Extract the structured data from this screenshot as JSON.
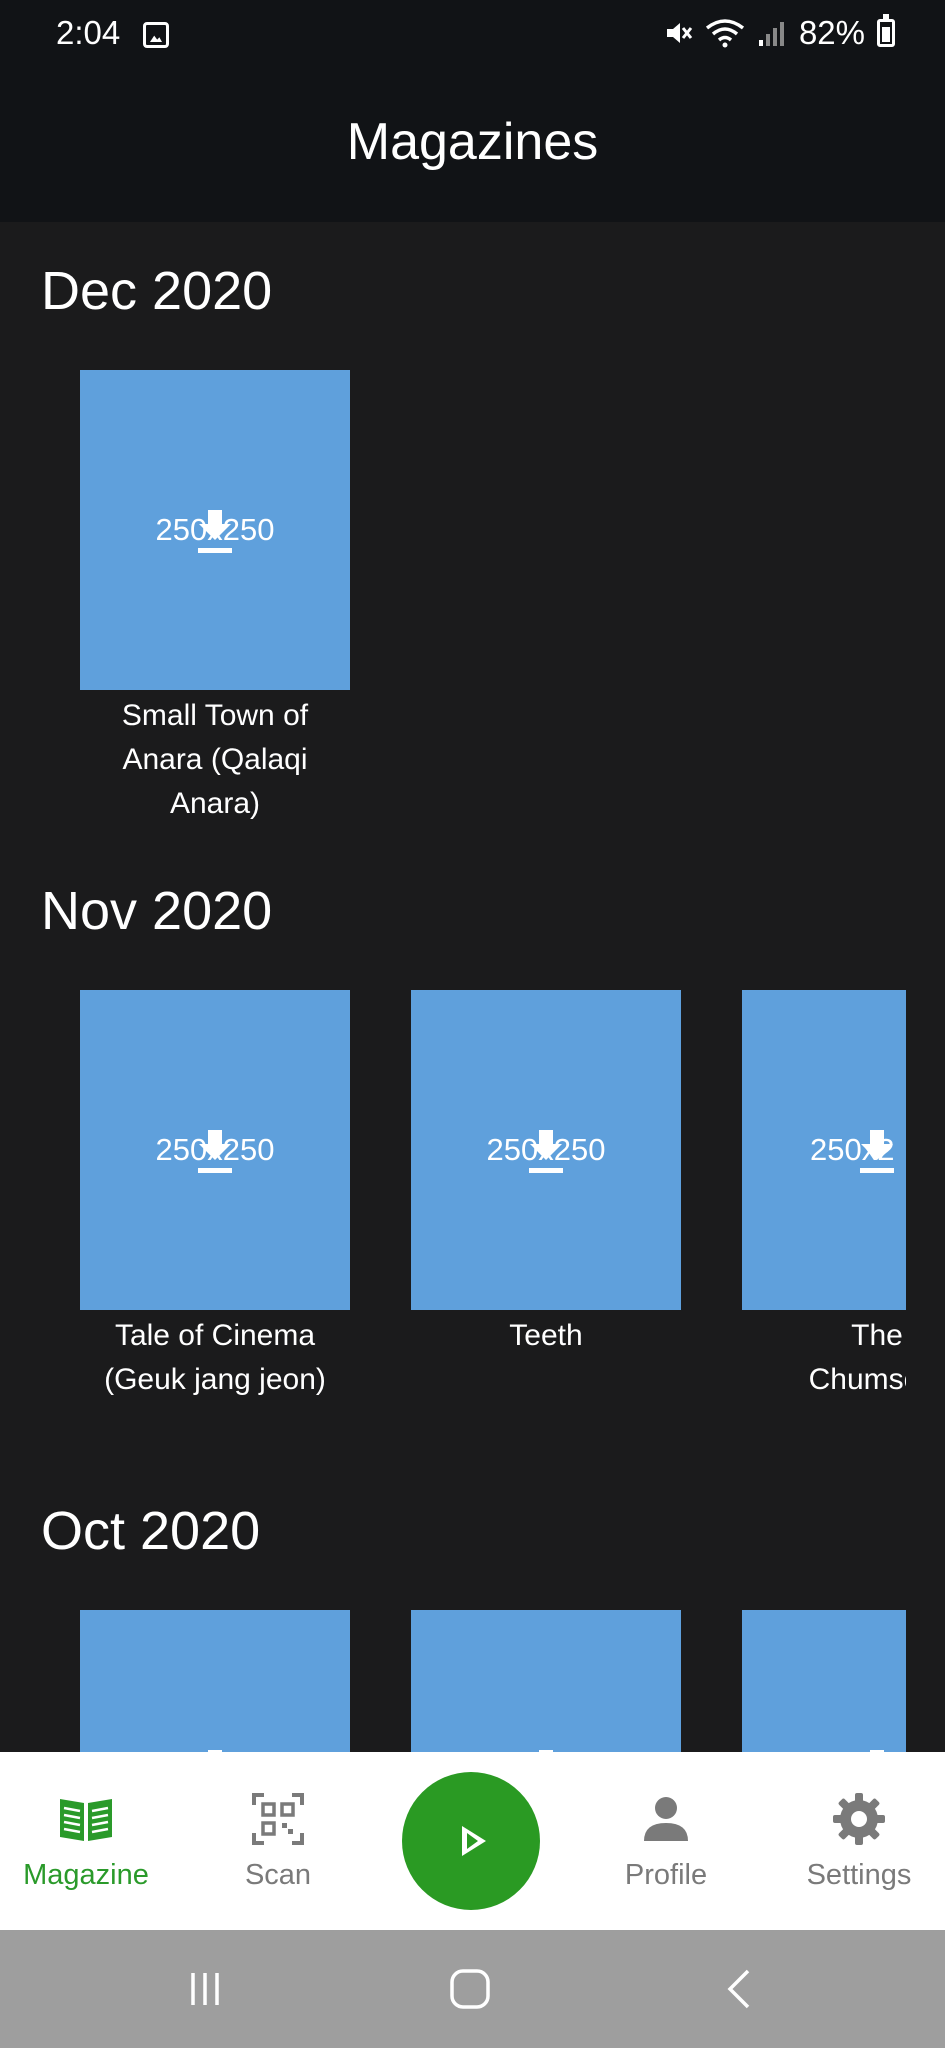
{
  "status_bar": {
    "time": "2:04",
    "battery": "82%",
    "icons": [
      "image-icon",
      "mute-icon",
      "wifi-icon",
      "signal-icon",
      "battery-charging-icon"
    ]
  },
  "app_bar": {
    "title": "Magazines"
  },
  "sections": [
    {
      "title": "Dec 2020",
      "items": [
        {
          "thumb_text": "250x250",
          "title_lines": [
            "Small Town of",
            "Anara (Qalaqi",
            "Anara)"
          ]
        }
      ]
    },
    {
      "title": "Nov 2020",
      "items": [
        {
          "thumb_text": "250x250",
          "title_lines": [
            "Tale of Cinema",
            "(Geuk jang jeon)"
          ]
        },
        {
          "thumb_text": "250x250",
          "title_lines": [
            "Teeth"
          ]
        },
        {
          "thumb_text": "250x2",
          "title_lines": [
            "The",
            "Chumscru"
          ]
        }
      ]
    },
    {
      "title": "Oct 2020",
      "items": [
        {
          "thumb_text": ""
        },
        {
          "thumb_text": ""
        },
        {
          "thumb_text": ""
        }
      ]
    }
  ],
  "bottom_nav": {
    "items": [
      {
        "label": "Magazine",
        "icon": "open-book-icon",
        "active": true
      },
      {
        "label": "Scan",
        "icon": "qr-code-icon",
        "active": false
      },
      {
        "label": "",
        "icon": "play-icon",
        "active": false
      },
      {
        "label": "Profile",
        "icon": "person-icon",
        "active": false
      },
      {
        "label": "Settings",
        "icon": "gear-icon",
        "active": false
      }
    ]
  },
  "colors": {
    "accent": "#2a9a23",
    "thumb": "#5fa0dc",
    "background": "#1b1b1c",
    "app_bar": "#111316"
  }
}
